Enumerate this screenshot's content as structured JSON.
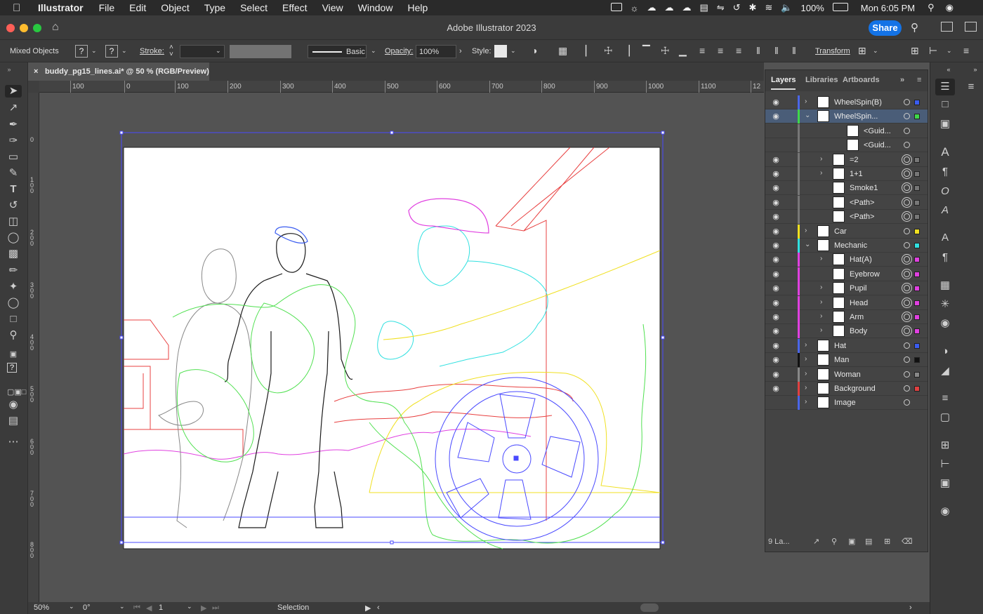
{
  "menubar": {
    "app_name": "Illustrator",
    "items": [
      "File",
      "Edit",
      "Object",
      "Type",
      "Select",
      "Effect",
      "View",
      "Window",
      "Help"
    ],
    "battery": "100%",
    "clock": "Mon 6:05 PM"
  },
  "window": {
    "title": "Adobe Illustrator 2023",
    "share_label": "Share"
  },
  "controlbar": {
    "selection_label": "Mixed Objects",
    "fill_value": "?",
    "stroke_color_value": "?",
    "stroke_label": "Stroke:",
    "brush_label": "Basic",
    "opacity_label": "Opacity:",
    "opacity_value": "100%",
    "style_label": "Style:",
    "transform_label": "Transform"
  },
  "document_tab": {
    "label": "buddy_pg15_lines.ai* @ 50 % (RGB/Preview)"
  },
  "rulers": {
    "horizontal_ticks": [
      "100",
      "0",
      "100",
      "200",
      "300",
      "400",
      "500",
      "600",
      "700",
      "800",
      "900",
      "1000",
      "1100",
      "12"
    ],
    "vertical_ticks": [
      "0",
      "1 0 0",
      "2 0 0",
      "3 0 0",
      "4 0 0",
      "5 0 0",
      "6 0 0",
      "7 0 0",
      "8 0 0"
    ]
  },
  "layers_panel": {
    "tabs": [
      "Layers",
      "Libraries",
      "Artboards"
    ],
    "rows": [
      {
        "name": "WheelSpin(B)",
        "color": "#4a66e8",
        "sq": "#3a5cf0",
        "target": "single",
        "indent": 0,
        "arrow": "right",
        "eye": true,
        "selected": false
      },
      {
        "name": "WheelSpin...",
        "color": "#3fd84a",
        "sq": "#3fd84a",
        "target": "single",
        "indent": 0,
        "arrow": "down",
        "eye": true,
        "selected": true
      },
      {
        "name": "<Guid...",
        "color": "#777777",
        "sq": "",
        "target": "single",
        "indent": 2,
        "arrow": "",
        "eye": false,
        "selected": false
      },
      {
        "name": "<Guid...",
        "color": "#777777",
        "sq": "",
        "target": "single",
        "indent": 2,
        "arrow": "",
        "eye": false,
        "selected": false
      },
      {
        "name": "=2",
        "color": "#777777",
        "sq": "#777777",
        "target": "double",
        "indent": 1,
        "arrow": "right",
        "eye": true,
        "selected": false
      },
      {
        "name": "1+1",
        "color": "#777777",
        "sq": "#777777",
        "target": "double",
        "indent": 1,
        "arrow": "right",
        "eye": true,
        "selected": false
      },
      {
        "name": "Smoke1",
        "color": "#777777",
        "sq": "#777777",
        "target": "double",
        "indent": 1,
        "arrow": "",
        "eye": true,
        "selected": false
      },
      {
        "name": "<Path>",
        "color": "#777777",
        "sq": "#777777",
        "target": "double",
        "indent": 1,
        "arrow": "",
        "eye": true,
        "selected": false
      },
      {
        "name": "<Path>",
        "color": "#777777",
        "sq": "#777777",
        "target": "double",
        "indent": 1,
        "arrow": "",
        "eye": true,
        "selected": false
      },
      {
        "name": "Car",
        "color": "#f0e020",
        "sq": "#f0e020",
        "target": "single",
        "indent": 0,
        "arrow": "right",
        "eye": true,
        "selected": false
      },
      {
        "name": "Mechanic",
        "color": "#30e0e0",
        "sq": "#30e0e0",
        "target": "single",
        "indent": 0,
        "arrow": "down",
        "eye": true,
        "selected": false
      },
      {
        "name": "Hat(A)",
        "color": "#e040e0",
        "sq": "#e040e0",
        "target": "double",
        "indent": 1,
        "arrow": "right",
        "eye": true,
        "selected": false
      },
      {
        "name": "Eyebrow",
        "color": "#e040e0",
        "sq": "#e040e0",
        "target": "double",
        "indent": 1,
        "arrow": "",
        "eye": true,
        "selected": false
      },
      {
        "name": "Pupil",
        "color": "#e040e0",
        "sq": "#e040e0",
        "target": "double",
        "indent": 1,
        "arrow": "right",
        "eye": true,
        "selected": false
      },
      {
        "name": "Head",
        "color": "#e040e0",
        "sq": "#e040e0",
        "target": "double",
        "indent": 1,
        "arrow": "right",
        "eye": true,
        "selected": false
      },
      {
        "name": "Arm",
        "color": "#e040e0",
        "sq": "#e040e0",
        "target": "double",
        "indent": 1,
        "arrow": "right",
        "eye": true,
        "selected": false
      },
      {
        "name": "Body",
        "color": "#e040e0",
        "sq": "#e040e0",
        "target": "double",
        "indent": 1,
        "arrow": "right",
        "eye": true,
        "selected": false
      },
      {
        "name": "Hat",
        "color": "#4a66e8",
        "sq": "#3a5cf0",
        "target": "single",
        "indent": 0,
        "arrow": "right",
        "eye": true,
        "selected": false
      },
      {
        "name": "Man",
        "color": "#111111",
        "sq": "#111111",
        "target": "single",
        "indent": 0,
        "arrow": "right",
        "eye": true,
        "selected": false
      },
      {
        "name": "Woman",
        "color": "#888888",
        "sq": "#888888",
        "target": "single",
        "indent": 0,
        "arrow": "right",
        "eye": true,
        "selected": false
      },
      {
        "name": "Background",
        "color": "#e04040",
        "sq": "#e04040",
        "target": "single",
        "indent": 0,
        "arrow": "right",
        "eye": true,
        "selected": false
      },
      {
        "name": "Image",
        "color": "#4a66e8",
        "sq": "",
        "target": "single",
        "indent": 0,
        "arrow": "right",
        "eye": false,
        "selected": false
      }
    ],
    "footer_count": "9 La..."
  },
  "statusbar": {
    "zoom": "50%",
    "rotation": "0°",
    "artboard": "1",
    "tool": "Selection"
  }
}
